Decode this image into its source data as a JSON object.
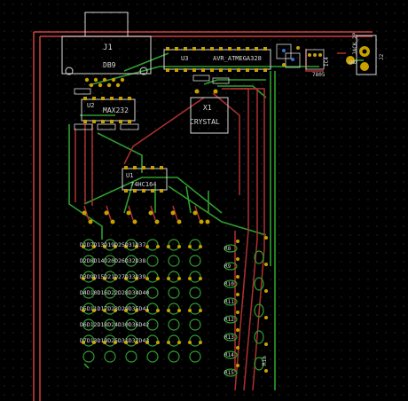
{
  "board": {
    "components": {
      "j1": "J1",
      "j1_value": "DB9",
      "u3": "U3",
      "u3_value": "AVR_ATMEGA328",
      "u2": "U2",
      "u2_value": "MAX232",
      "x1": "X1",
      "x1_value": "CRYSTAL",
      "u1": "U1",
      "u1_value": "74HC164",
      "vreg": "7805",
      "jack_label": "JACK_2P",
      "jack_ref": "J2",
      "gnd": "GND",
      "ic4": "IC4"
    },
    "led_rows": [
      "D1D7D13D19D25D31D37",
      "D2D8D14D20D26D32D38",
      "D3D9D15D21D27D33D39",
      "D4D10D16D22D28D34D40",
      "D5D11D17D23D29D35D41",
      "D6D12D18D24D30D36D42",
      "D7D13D19D25D31D37D43"
    ],
    "resistors": [
      "R8",
      "R9",
      "R10",
      "R11",
      "R12",
      "R13",
      "R14",
      "R15",
      "R16"
    ],
    "colors": {
      "background": "#000000",
      "grid": "#3a3a3a",
      "copper_top": "#b03030",
      "copper_bottom": "#2e9e2e",
      "silkscreen": "#d8d8d8",
      "pad": "#c8a000",
      "edge": "#d04040"
    }
  }
}
